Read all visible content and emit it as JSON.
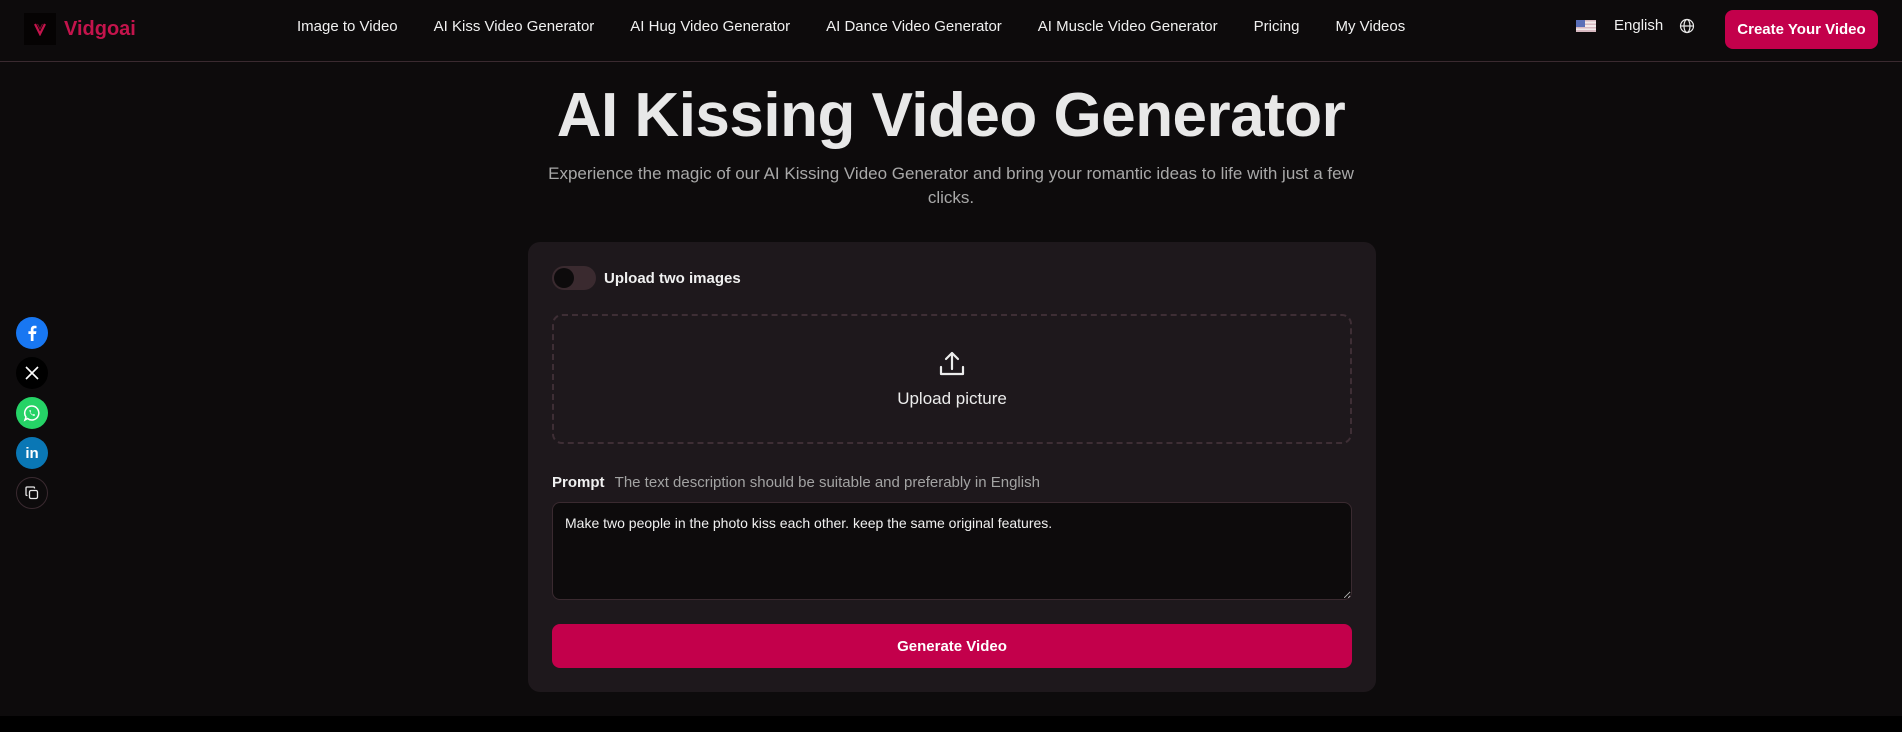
{
  "header": {
    "brand": "Vidgoai",
    "nav": [
      {
        "label": "Image to Video"
      },
      {
        "label": "AI Kiss Video Generator"
      },
      {
        "label": "AI Hug Video Generator"
      },
      {
        "label": "AI Dance Video Generator"
      },
      {
        "label": "AI Muscle Video Generator"
      },
      {
        "label": "Pricing"
      },
      {
        "label": "My Videos"
      }
    ],
    "language": "English",
    "language_flag_icon": "us-flag-icon",
    "cta_label": "Create Your Video"
  },
  "social": [
    "facebook",
    "x",
    "whatsapp",
    "linkedin",
    "copy-link"
  ],
  "hero": {
    "title": "AI Kissing Video Generator",
    "subtitle": "Experience the magic of our AI Kissing Video Generator and bring your romantic ideas to life with just a few clicks."
  },
  "form": {
    "toggle_label": "Upload two images",
    "toggle_on": false,
    "upload_label": "Upload picture",
    "prompt_label": "Prompt",
    "prompt_hint": "The text description should be suitable and preferably in English",
    "prompt_value": "Make two people in the photo kiss each other. keep the same original features.",
    "generate_label": "Generate Video"
  },
  "colors": {
    "accent": "#c3004b",
    "background": "#0d0b0c",
    "card": "#1e181c"
  }
}
